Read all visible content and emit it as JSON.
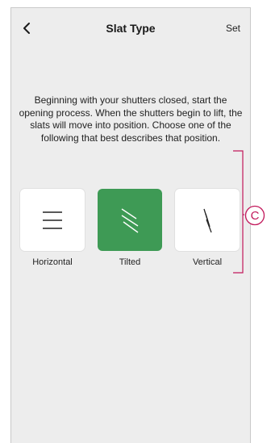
{
  "header": {
    "back_icon": "chevron-left-icon",
    "title": "Slat Type",
    "set_label": "Set"
  },
  "instructions": "Beginning with your shutters closed, start the opening process. When the shutters begin to lift, the slats will move into position. Choose one of the following that best describes that position.",
  "options": [
    {
      "label": "Horizontal",
      "icon": "horizontal-slats-icon",
      "selected": false
    },
    {
      "label": "Tilted",
      "icon": "tilted-slats-icon",
      "selected": true
    },
    {
      "label": "Vertical",
      "icon": "vertical-slats-icon",
      "selected": false
    }
  ],
  "callout": {
    "letter": "C"
  },
  "colors": {
    "selected": "#3e9a55",
    "background": "#ededed",
    "callout": "#c2185b"
  }
}
